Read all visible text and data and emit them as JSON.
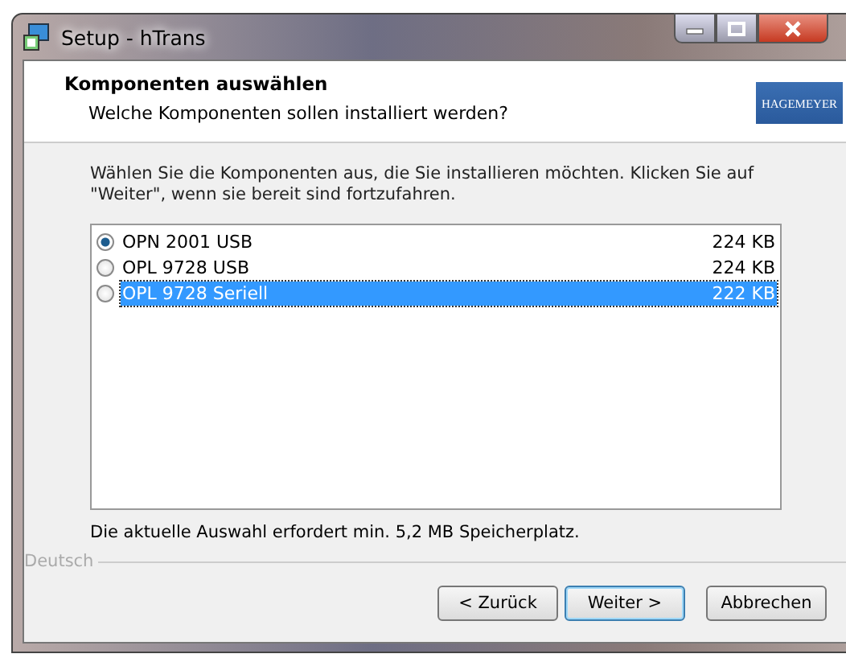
{
  "window": {
    "title": "Setup - hTrans"
  },
  "header": {
    "title": "Komponenten auswählen",
    "subtitle": "Welche Komponenten sollen installiert werden?",
    "logo_text": "HAGEMEYER"
  },
  "instructions": "Wählen Sie die Komponenten aus, die Sie installieren möchten. Klicken Sie auf \"Weiter\", wenn sie bereit sind fortzufahren.",
  "components": [
    {
      "name": "OPN 2001 USB",
      "size": "224 KB",
      "checked": true,
      "selected": false
    },
    {
      "name": "OPL 9728 USB",
      "size": "224 KB",
      "checked": false,
      "selected": false
    },
    {
      "name": "OPL 9728 Seriell",
      "size": "222 KB",
      "checked": false,
      "selected": true
    }
  ],
  "space_note": "Die aktuelle Auswahl erfordert min. 5,2 MB Speicherplatz.",
  "language": "Deutsch",
  "buttons": [
    {
      "label": "< Zurück",
      "default": false
    },
    {
      "label": "Weiter >",
      "default": true
    },
    {
      "label": "Abbrechen",
      "default": false
    }
  ]
}
